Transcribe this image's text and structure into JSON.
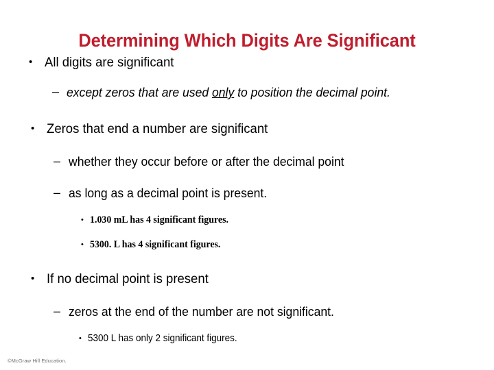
{
  "slide": {
    "title": "Determining Which Digits Are Significant",
    "title_color": "#bf1e2e",
    "background_color": "#ffffff",
    "bullet_markers": {
      "level1": "•",
      "level2": "–",
      "level3": "•"
    },
    "content": [
      {
        "level": 1,
        "text": "All digits are significant"
      },
      {
        "level": 2,
        "style": "italic",
        "text_before_underline": "except zeros that are used ",
        "underlined_text": "only",
        "text_after_underline": " to position the decimal point."
      },
      {
        "level": 1,
        "text": "Zeros that end a number are significant"
      },
      {
        "level": 2,
        "text": "whether they occur before or after the decimal point"
      },
      {
        "level": 2,
        "text": "as long as a decimal point is present."
      },
      {
        "level": 3,
        "text": "1.030 mL has 4 significant figures."
      },
      {
        "level": 3,
        "text": "5300. L has 4 significant figures."
      },
      {
        "level": 1,
        "text": "If no decimal point is present"
      },
      {
        "level": 2,
        "text": "zeros at the end of the number are not significant."
      },
      {
        "level": 3,
        "text": "5300 L has only 2 significant figures."
      }
    ]
  },
  "footer": {
    "copyright": "©McGraw Hill Education."
  }
}
